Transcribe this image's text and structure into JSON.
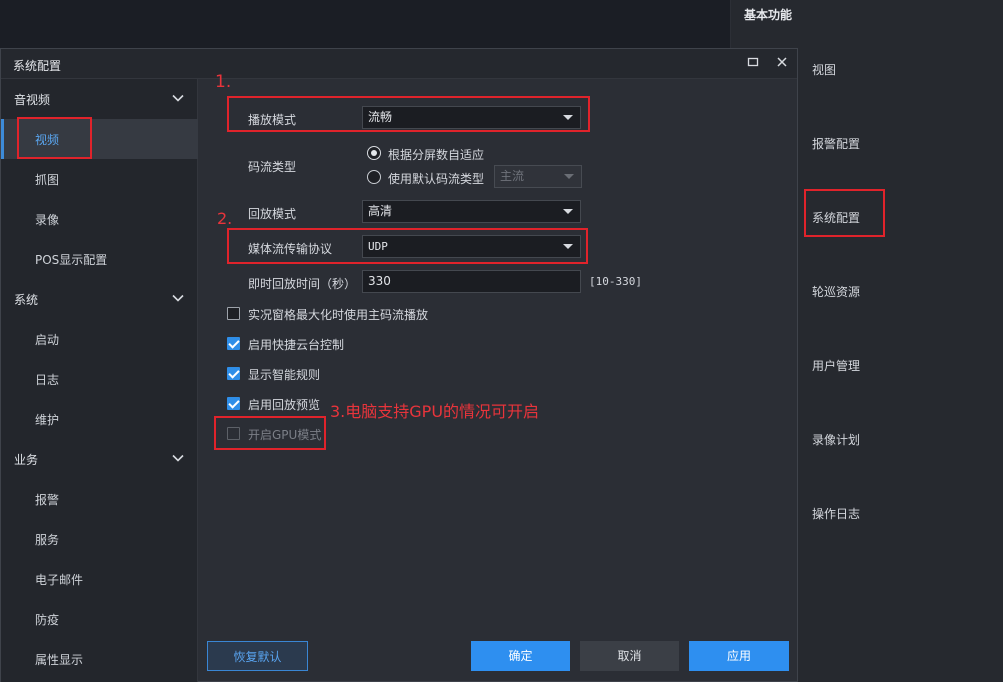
{
  "right_panel": {
    "title": "基本功能",
    "items": [
      "视图",
      "报警配置",
      "系统配置",
      "轮巡资源",
      "用户管理",
      "录像计划",
      "操作日志"
    ]
  },
  "dialog": {
    "title": "系统配置",
    "maximize_icon": "maximize-icon",
    "close_icon": "close-icon"
  },
  "sidebar": {
    "groups": [
      {
        "label": "音视频",
        "items": [
          "视频",
          "抓图",
          "录像",
          "POS显示配置"
        ]
      },
      {
        "label": "系统",
        "items": [
          "启动",
          "日志",
          "维护"
        ]
      },
      {
        "label": "业务",
        "items": [
          "报警",
          "服务",
          "电子邮件",
          "防疫",
          "属性显示"
        ]
      }
    ],
    "active_item": "视频"
  },
  "form": {
    "play_mode_label": "播放模式",
    "play_mode_value": "流畅",
    "stream_type_label": "码流类型",
    "stream_option_auto": "根据分屏数自适应",
    "stream_option_default": "使用默认码流类型",
    "default_stream_value": "主流",
    "playback_mode_label": "回放模式",
    "playback_mode_value": "高清",
    "protocol_label": "媒体流传输协议",
    "protocol_value": "UDP",
    "instant_playback_label": "即时回放时间（秒）",
    "instant_playback_value": "330",
    "instant_playback_range": "[10-330]",
    "chk_main_stream": "实况窗格最大化时使用主码流播放",
    "chk_ptz": "启用快捷云台控制",
    "chk_smart_rules": "显示智能规则",
    "chk_playback_preview": "启用回放预览",
    "chk_gpu": "开启GPU模式"
  },
  "annotations": {
    "a1": "1.",
    "a2": "2.",
    "a3": "3.电脑支持GPU的情况可开启"
  },
  "footer": {
    "restore": "恢复默认",
    "ok": "确定",
    "cancel": "取消",
    "apply": "应用"
  },
  "colors": {
    "accent": "#2e8ff0",
    "annotation_red": "#e0232b"
  }
}
